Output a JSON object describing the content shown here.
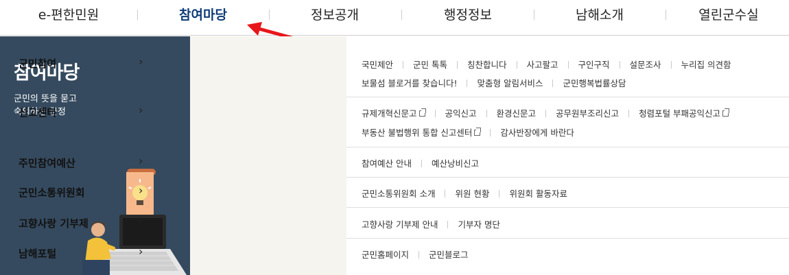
{
  "topnav": {
    "items": [
      "e-편한민원",
      "참여마당",
      "정보공개",
      "행정정보",
      "남해소개",
      "열린군수실"
    ],
    "active_index": 1
  },
  "left_panel": {
    "title": "참여마당",
    "desc_line1": "군민의 뜻을 묻고",
    "desc_line2": "숙의하는 군정"
  },
  "menu": [
    {
      "label": "군민참여",
      "lines": [
        [
          {
            "t": "국민제안"
          },
          {
            "t": "군민 톡톡"
          },
          {
            "t": "칭찬합니다"
          },
          {
            "t": "사고팔고"
          },
          {
            "t": "구인구직"
          },
          {
            "t": "설문조사"
          },
          {
            "t": "누리집 의견함"
          }
        ],
        [
          {
            "t": "보물섬 블로거를 찾습니다!"
          },
          {
            "t": "맞춤형 알림서비스"
          },
          {
            "t": "군민행복법률상담"
          }
        ]
      ]
    },
    {
      "label": "신고센터",
      "lines": [
        [
          {
            "t": "규제개혁신문고",
            "ext": true
          },
          {
            "t": "공익신고"
          },
          {
            "t": "환경신문고"
          },
          {
            "t": "공무원부조리신고"
          },
          {
            "t": "청렴포털 부패공익신고",
            "ext": true
          }
        ],
        [
          {
            "t": "부동산 불법행위 통합 신고센터",
            "ext": true
          },
          {
            "t": "감사반장에게 바란다"
          }
        ]
      ]
    },
    {
      "label": "주민참여예산",
      "lines": [
        [
          {
            "t": "참여예산 안내"
          },
          {
            "t": "예산낭비신고"
          }
        ]
      ]
    },
    {
      "label": "군민소통위원회",
      "lines": [
        [
          {
            "t": "군민소통위원회 소개"
          },
          {
            "t": "위원 현황"
          },
          {
            "t": "위원회 활동자료"
          }
        ]
      ]
    },
    {
      "label": "고향사랑 기부제",
      "lines": [
        [
          {
            "t": "고향사랑 기부제 안내"
          },
          {
            "t": "기부자 명단"
          }
        ]
      ]
    },
    {
      "label": "남해포털",
      "lines": [
        [
          {
            "t": "군민홈페이지"
          },
          {
            "t": "군민블로그"
          }
        ]
      ]
    }
  ],
  "icons": {
    "chevron": "chevron-right-icon",
    "external": "external-link-icon",
    "annotation": "red-arrow"
  },
  "colors": {
    "active_nav": "#0d3b78",
    "left_panel_bg": "#354a5e",
    "category_bg": "#f5f4ef",
    "arrow": "#e8161b"
  }
}
